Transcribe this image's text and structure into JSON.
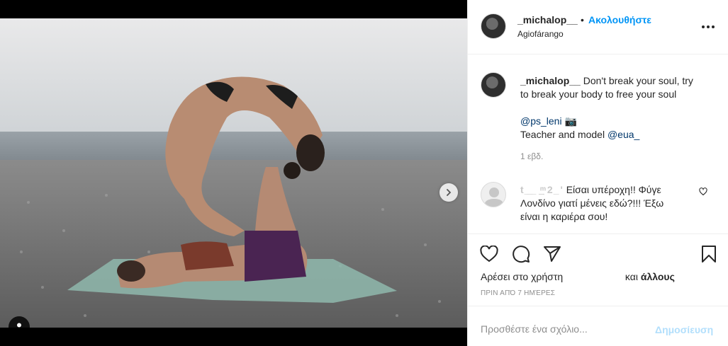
{
  "post": {
    "username": "_michalop__",
    "separator": "•",
    "follow_label": "Ακολουθήστε",
    "location": "Agiofárango",
    "more_icon": "more-options-icon"
  },
  "caption": {
    "username": "_michalop__",
    "text_line1": "Don't break your soul, try",
    "text_line2": "to break your body to free your soul",
    "mention1": "@ps_leni",
    "camera_emoji": "📷",
    "text_line4_prefix": "Teacher and model",
    "mention2": "@eua_",
    "time": "1 εβδ."
  },
  "comment": {
    "username": "t_̲_ ͢ ͫ 2 ̲ ʹ",
    "text_line1": "Είσαι υπέροχη!! Φύγε",
    "text_line2": "Λονδίνο γιατί μένεις εδώ?!!! Έξω",
    "text_line3": "είναι η καριέρα σου!"
  },
  "likes": {
    "prefix": "Αρέσει στο χρήστη",
    "suffix_plain": "και",
    "suffix_bold": "άλλους"
  },
  "post_date": "ΠΡΙΝ ΑΠΌ 7 ΗΜΈΡΕΣ",
  "add_comment": {
    "placeholder": "Προσθέστε ένα σχόλιο...",
    "post_label": "Δημοσίευση"
  },
  "carousel": {
    "slide_count": 6,
    "active_index": 0
  },
  "colors": {
    "accent": "#0095f6",
    "mention": "#00376b",
    "muted": "#8e8e8e",
    "post_disabled": "#b2dffc"
  }
}
